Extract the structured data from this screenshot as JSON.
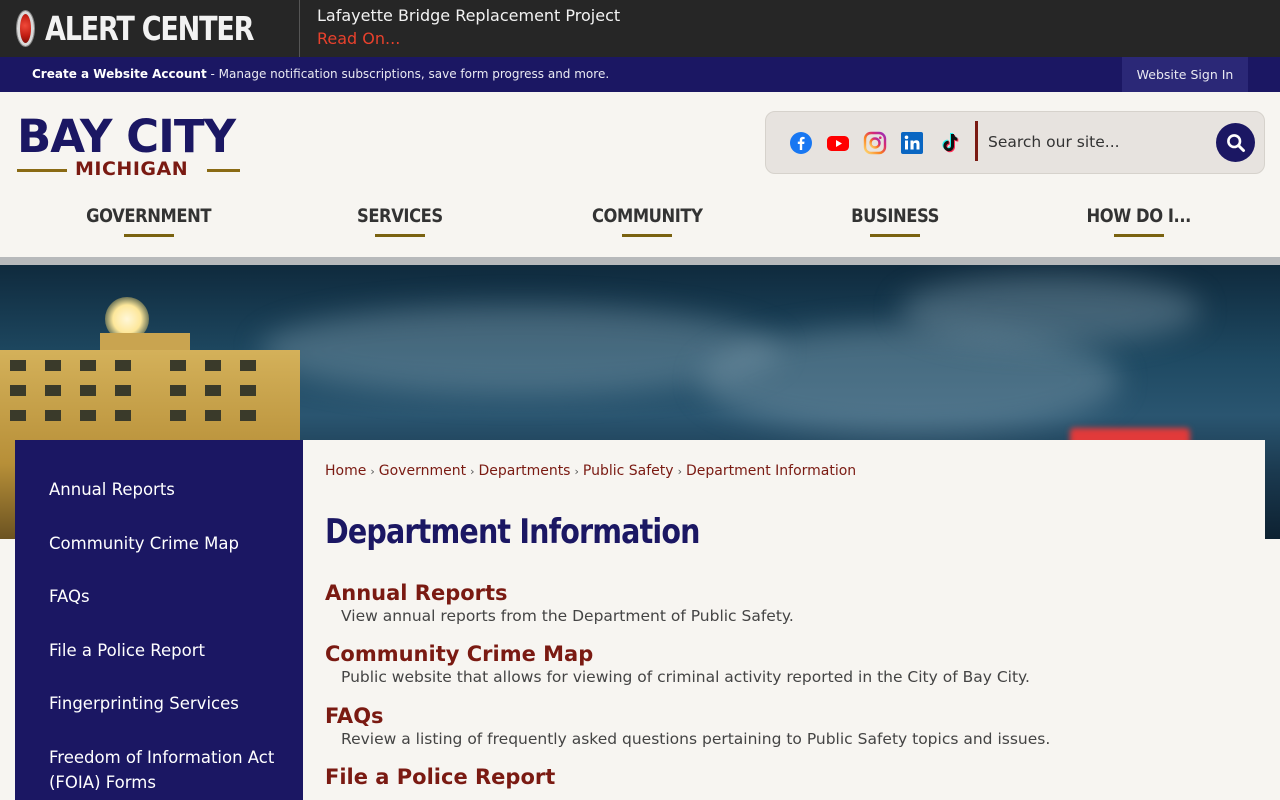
{
  "alert": {
    "label": "ALERT CENTER",
    "headline": "Lafayette Bridge Replacement Project",
    "read_on": "Read On..."
  },
  "account_bar": {
    "create_link": "Create a Website Account",
    "description": " - Manage notification subscriptions, save form progress and more.",
    "sign_in": "Website Sign In"
  },
  "logo": {
    "main": "BAY CITY",
    "sub": "MICHIGAN"
  },
  "social": [
    "facebook-icon",
    "youtube-icon",
    "instagram-icon",
    "linkedin-icon",
    "tiktok-icon"
  ],
  "search": {
    "placeholder": "Search our site..."
  },
  "nav": [
    {
      "label": "GOVERNMENT"
    },
    {
      "label": "SERVICES"
    },
    {
      "label": "COMMUNITY"
    },
    {
      "label": "BUSINESS"
    },
    {
      "label": "HOW DO I..."
    }
  ],
  "sidebar": {
    "items": [
      {
        "label": "Annual Reports"
      },
      {
        "label": "Community Crime Map"
      },
      {
        "label": "FAQs"
      },
      {
        "label": "File a Police Report"
      },
      {
        "label": "Fingerprinting Services"
      },
      {
        "label": "Freedom of Information Act (FOIA) Forms"
      }
    ]
  },
  "breadcrumb": [
    "Home",
    "Government",
    "Departments",
    "Public Safety",
    "Department Information"
  ],
  "page_title": "Department Information",
  "entries": [
    {
      "title": "Annual Reports",
      "desc": "View annual reports from the Department of Public Safety."
    },
    {
      "title": "Community Crime Map",
      "desc": "Public website that allows for viewing of criminal activity reported in the City of Bay City."
    },
    {
      "title": "FAQs",
      "desc": "Review a listing of frequently asked questions pertaining to Public Safety topics and issues."
    },
    {
      "title": "File a Police Report",
      "desc": ""
    }
  ],
  "colors": {
    "navy": "#1b1763",
    "maroon": "#7a1a12",
    "gold": "#7a6210",
    "alert_red": "#e8412c"
  }
}
